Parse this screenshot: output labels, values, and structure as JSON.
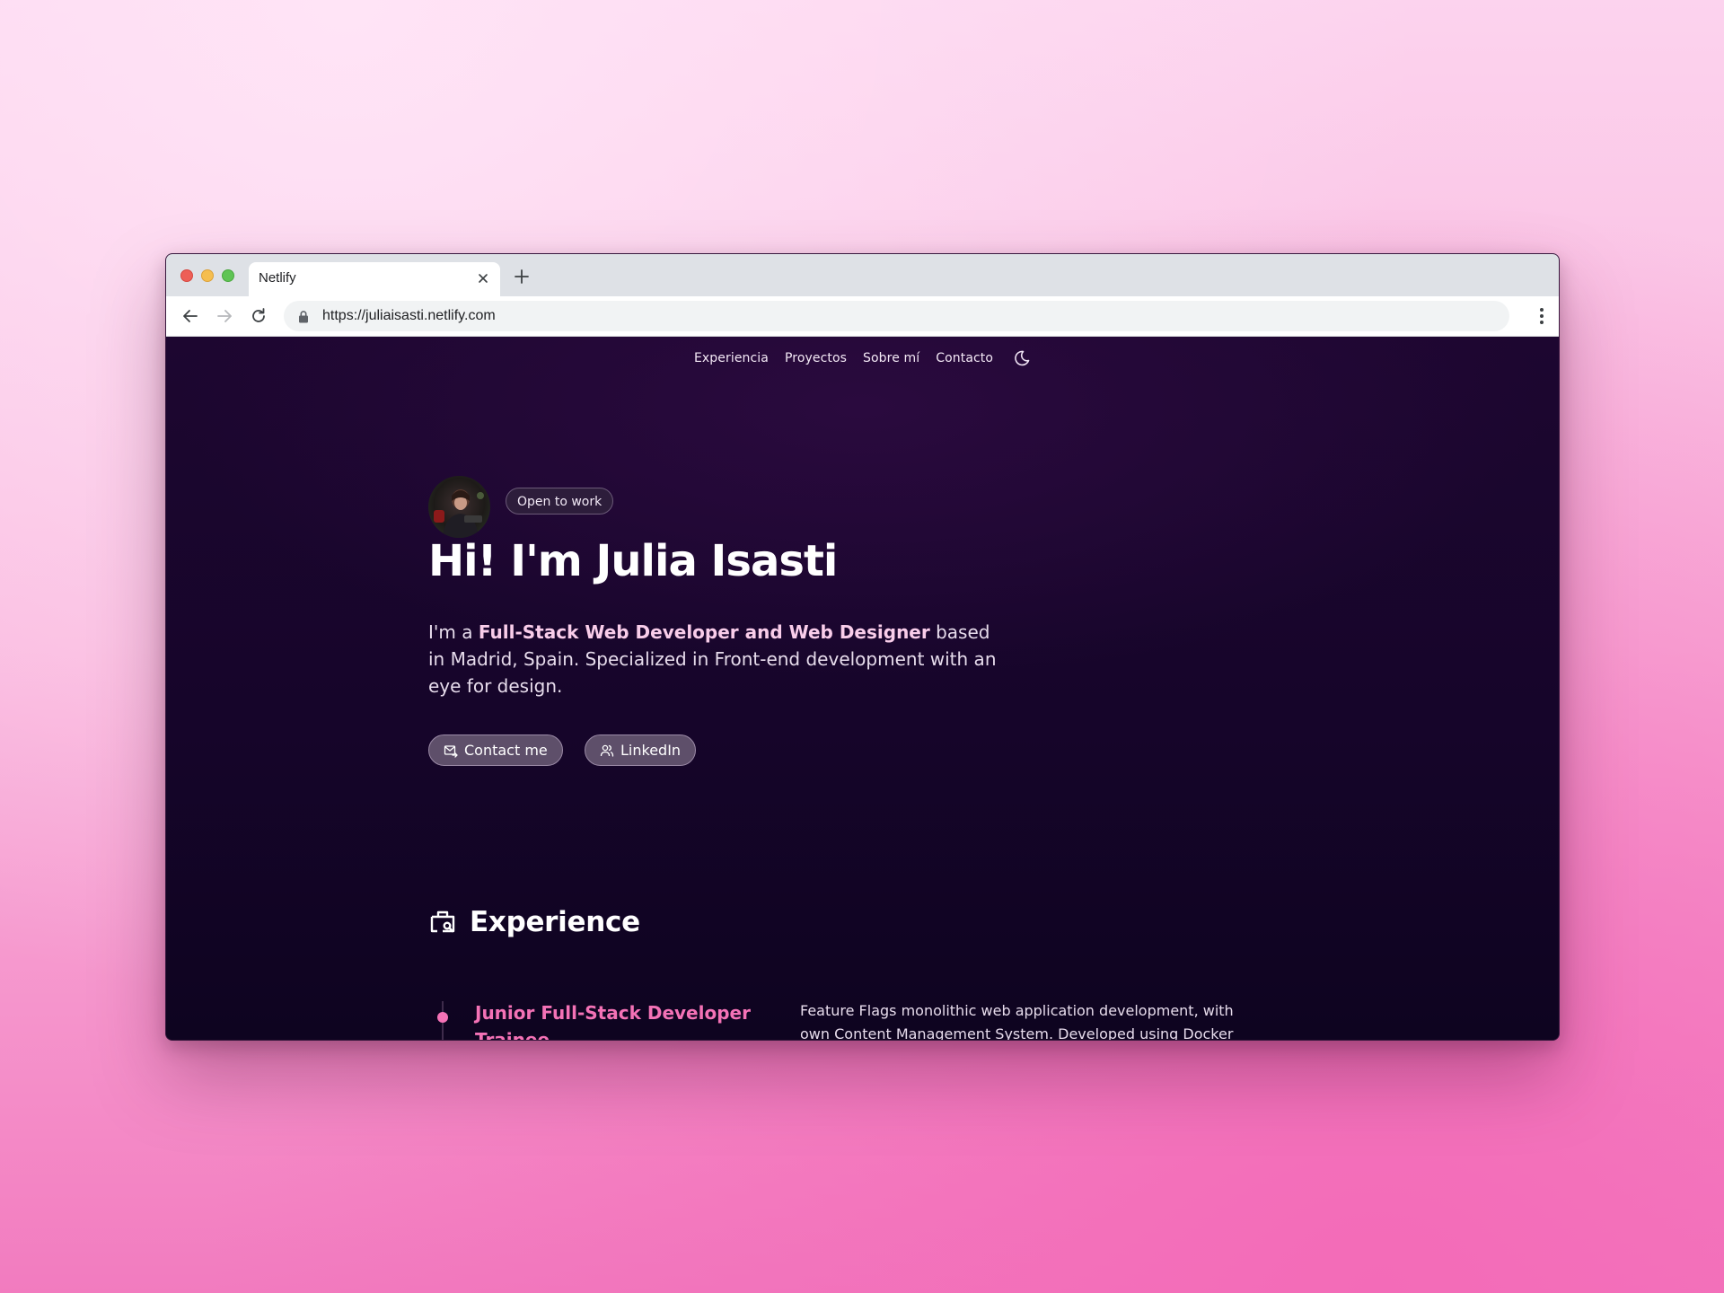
{
  "browser": {
    "tab_title": "Netlify",
    "url": "https://juliaisasti.netlify.com"
  },
  "nav": {
    "items": [
      {
        "label": "Experiencia"
      },
      {
        "label": "Proyectos"
      },
      {
        "label": "Sobre mí"
      },
      {
        "label": "Contacto"
      }
    ],
    "theme_icon": "moon-icon"
  },
  "hero": {
    "badge": "Open to work",
    "title": "Hi! I'm Julia Isasti",
    "intro_prefix": "I'm a ",
    "intro_highlight": "Full-Stack Web Developer and Web Designer",
    "intro_suffix": " based in Madrid, Spain. Specialized in Front-end development with an eye for design.",
    "buttons": {
      "contact_label": "Contact me",
      "contact_icon": "mail-forward-icon",
      "linkedin_label": "LinkedIn",
      "linkedin_icon": "users-icon"
    }
  },
  "experience": {
    "heading": "Experience",
    "heading_icon": "briefcase-search-icon",
    "items": [
      {
        "title": "Junior Full-Stack Developer Trainee",
        "description": "Feature Flags monolithic web application development, with own Content Management System. Developed using Docker"
      }
    ]
  },
  "colors": {
    "accent": "#f472b6",
    "page_background": "#16052a",
    "highlight_text": "#f9cdea"
  }
}
